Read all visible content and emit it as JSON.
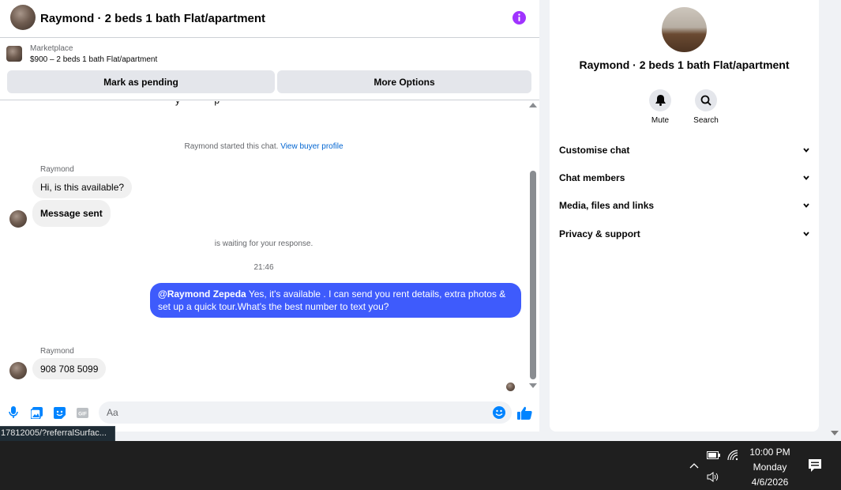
{
  "header": {
    "title": "Raymond · 2 beds 1 bath Flat/apartment"
  },
  "listing": {
    "kind": "Marketplace",
    "price_title": "$900 – 2 beds 1 bath Flat/apartment",
    "pending_label": "Mark as pending",
    "more_label": "More Options"
  },
  "messages": {
    "started_text": "Raymond started this chat.",
    "buyer_link": "View buyer profile",
    "sender1": "Raymond",
    "msg1": "Hi, is this available?",
    "msg2": "Message sent",
    "waiting_text": "is waiting for your response.",
    "time": "21:46",
    "out_mention": "@Raymond Zepeda",
    "out_text": " Yes, it's available .  I can send you rent details, extra photos & set up a quick tour.What's the best number to text you?",
    "sender2": "Raymond",
    "msg3": "908 708 5099"
  },
  "composer": {
    "placeholder": "Aa",
    "gif_label": "GIF"
  },
  "side": {
    "title": "Raymond · 2 beds 1 bath Flat/apartment",
    "mute_label": "Mute",
    "search_label": "Search",
    "sections": [
      "Customise chat",
      "Chat members",
      "Media, files and links",
      "Privacy & support"
    ]
  },
  "status_url": "17812005/?referralSurfac...",
  "taskbar": {
    "time": "10:00 PM",
    "day": "Monday",
    "date": "4/6/2026"
  },
  "colors": {
    "accent": "#0084ff",
    "outgoing_bubble": "#3e5bfc",
    "info": "#a033ff"
  }
}
